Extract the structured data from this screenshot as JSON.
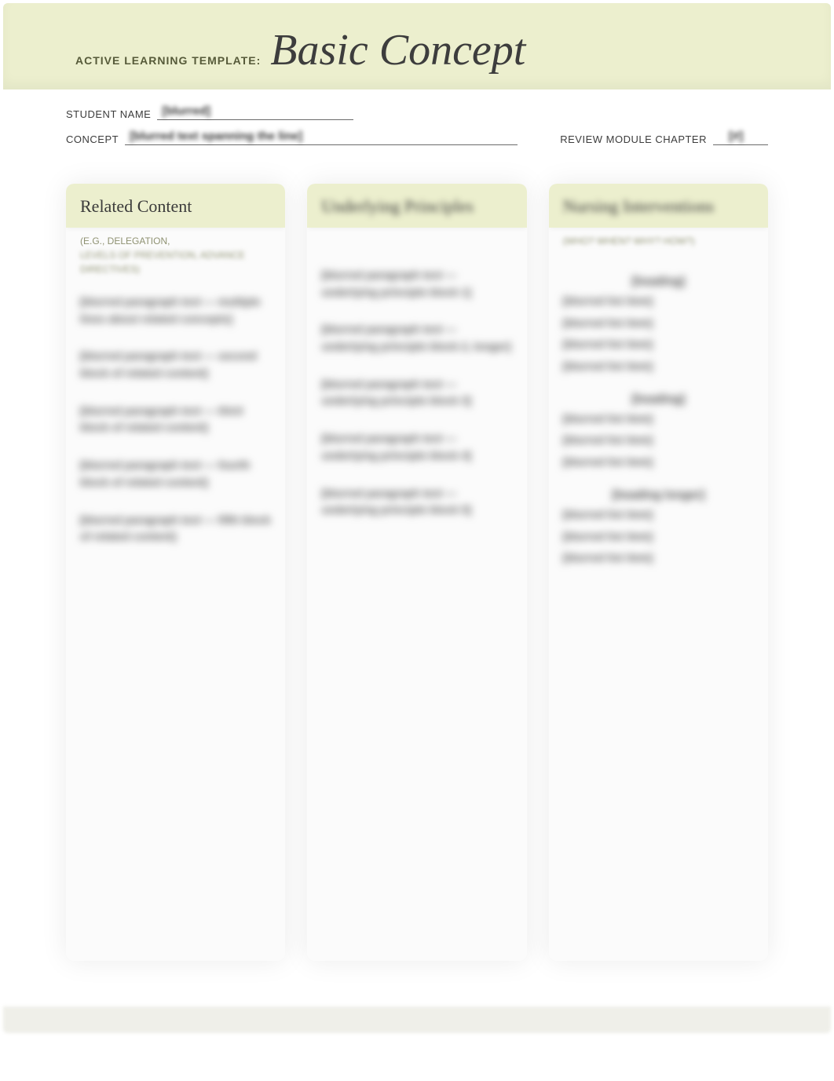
{
  "banner": {
    "label": "ACTIVE LEARNING TEMPLATE:",
    "title": "Basic Concept"
  },
  "info": {
    "student_label": "STUDENT NAME",
    "student_value": "[blurred]",
    "concept_label": "CONCEPT",
    "concept_value": "[blurred text spanning the line]",
    "chapter_label": "REVIEW MODULE CHAPTER",
    "chapter_value": "[#]"
  },
  "columns": {
    "left": {
      "title": "Related Content",
      "subtitle_first_line": "(E.G., DELEGATION,",
      "subtitle_rest": "LEVELS OF PREVENTION, ADVANCE DIRECTIVES)",
      "paras": [
        "[blurred paragraph text — multiple lines about related concepts]",
        "[blurred paragraph text — second block of related content]",
        "[blurred paragraph text — third block of related content]",
        "[blurred paragraph text — fourth block of related content]",
        "[blurred paragraph text — fifth block of related content]"
      ]
    },
    "middle": {
      "title": "Underlying Principles",
      "paras": [
        "[blurred paragraph text — underlying principle block 1]",
        "[blurred paragraph text — underlying principle block 2, longer]",
        "[blurred paragraph text — underlying principle block 3]",
        "[blurred paragraph text — underlying principle block 4]",
        "[blurred paragraph text — underlying principle block 5]"
      ]
    },
    "right": {
      "title": "Nursing Interventions",
      "subtitle": "(WHO? WHEN? WHY? HOW?)",
      "groups": [
        {
          "head": "[heading]",
          "items": [
            "[blurred list item]",
            "[blurred list item]",
            "[blurred list item]",
            "[blurred list item]"
          ]
        },
        {
          "head": "[heading]",
          "items": [
            "[blurred list item]",
            "[blurred list item]",
            "[blurred list item]"
          ]
        },
        {
          "head": "[heading longer]",
          "items": [
            "[blurred list item]",
            "[blurred list item]",
            "[blurred list item]"
          ]
        }
      ]
    }
  }
}
